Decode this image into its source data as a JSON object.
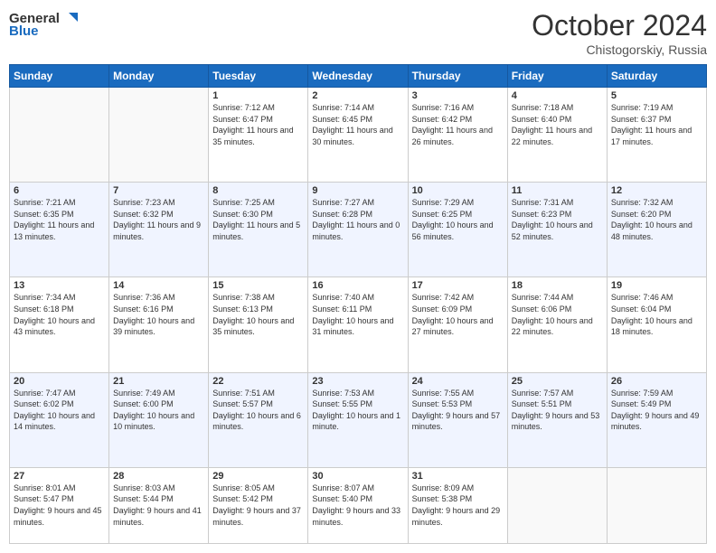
{
  "header": {
    "logo_line1": "General",
    "logo_line2": "Blue",
    "month_title": "October 2024",
    "location": "Chistogorskiy, Russia"
  },
  "days_of_week": [
    "Sunday",
    "Monday",
    "Tuesday",
    "Wednesday",
    "Thursday",
    "Friday",
    "Saturday"
  ],
  "weeks": [
    [
      {
        "day": "",
        "info": ""
      },
      {
        "day": "",
        "info": ""
      },
      {
        "day": "1",
        "info": "Sunrise: 7:12 AM\nSunset: 6:47 PM\nDaylight: 11 hours and 35 minutes."
      },
      {
        "day": "2",
        "info": "Sunrise: 7:14 AM\nSunset: 6:45 PM\nDaylight: 11 hours and 30 minutes."
      },
      {
        "day": "3",
        "info": "Sunrise: 7:16 AM\nSunset: 6:42 PM\nDaylight: 11 hours and 26 minutes."
      },
      {
        "day": "4",
        "info": "Sunrise: 7:18 AM\nSunset: 6:40 PM\nDaylight: 11 hours and 22 minutes."
      },
      {
        "day": "5",
        "info": "Sunrise: 7:19 AM\nSunset: 6:37 PM\nDaylight: 11 hours and 17 minutes."
      }
    ],
    [
      {
        "day": "6",
        "info": "Sunrise: 7:21 AM\nSunset: 6:35 PM\nDaylight: 11 hours and 13 minutes."
      },
      {
        "day": "7",
        "info": "Sunrise: 7:23 AM\nSunset: 6:32 PM\nDaylight: 11 hours and 9 minutes."
      },
      {
        "day": "8",
        "info": "Sunrise: 7:25 AM\nSunset: 6:30 PM\nDaylight: 11 hours and 5 minutes."
      },
      {
        "day": "9",
        "info": "Sunrise: 7:27 AM\nSunset: 6:28 PM\nDaylight: 11 hours and 0 minutes."
      },
      {
        "day": "10",
        "info": "Sunrise: 7:29 AM\nSunset: 6:25 PM\nDaylight: 10 hours and 56 minutes."
      },
      {
        "day": "11",
        "info": "Sunrise: 7:31 AM\nSunset: 6:23 PM\nDaylight: 10 hours and 52 minutes."
      },
      {
        "day": "12",
        "info": "Sunrise: 7:32 AM\nSunset: 6:20 PM\nDaylight: 10 hours and 48 minutes."
      }
    ],
    [
      {
        "day": "13",
        "info": "Sunrise: 7:34 AM\nSunset: 6:18 PM\nDaylight: 10 hours and 43 minutes."
      },
      {
        "day": "14",
        "info": "Sunrise: 7:36 AM\nSunset: 6:16 PM\nDaylight: 10 hours and 39 minutes."
      },
      {
        "day": "15",
        "info": "Sunrise: 7:38 AM\nSunset: 6:13 PM\nDaylight: 10 hours and 35 minutes."
      },
      {
        "day": "16",
        "info": "Sunrise: 7:40 AM\nSunset: 6:11 PM\nDaylight: 10 hours and 31 minutes."
      },
      {
        "day": "17",
        "info": "Sunrise: 7:42 AM\nSunset: 6:09 PM\nDaylight: 10 hours and 27 minutes."
      },
      {
        "day": "18",
        "info": "Sunrise: 7:44 AM\nSunset: 6:06 PM\nDaylight: 10 hours and 22 minutes."
      },
      {
        "day": "19",
        "info": "Sunrise: 7:46 AM\nSunset: 6:04 PM\nDaylight: 10 hours and 18 minutes."
      }
    ],
    [
      {
        "day": "20",
        "info": "Sunrise: 7:47 AM\nSunset: 6:02 PM\nDaylight: 10 hours and 14 minutes."
      },
      {
        "day": "21",
        "info": "Sunrise: 7:49 AM\nSunset: 6:00 PM\nDaylight: 10 hours and 10 minutes."
      },
      {
        "day": "22",
        "info": "Sunrise: 7:51 AM\nSunset: 5:57 PM\nDaylight: 10 hours and 6 minutes."
      },
      {
        "day": "23",
        "info": "Sunrise: 7:53 AM\nSunset: 5:55 PM\nDaylight: 10 hours and 1 minute."
      },
      {
        "day": "24",
        "info": "Sunrise: 7:55 AM\nSunset: 5:53 PM\nDaylight: 9 hours and 57 minutes."
      },
      {
        "day": "25",
        "info": "Sunrise: 7:57 AM\nSunset: 5:51 PM\nDaylight: 9 hours and 53 minutes."
      },
      {
        "day": "26",
        "info": "Sunrise: 7:59 AM\nSunset: 5:49 PM\nDaylight: 9 hours and 49 minutes."
      }
    ],
    [
      {
        "day": "27",
        "info": "Sunrise: 8:01 AM\nSunset: 5:47 PM\nDaylight: 9 hours and 45 minutes."
      },
      {
        "day": "28",
        "info": "Sunrise: 8:03 AM\nSunset: 5:44 PM\nDaylight: 9 hours and 41 minutes."
      },
      {
        "day": "29",
        "info": "Sunrise: 8:05 AM\nSunset: 5:42 PM\nDaylight: 9 hours and 37 minutes."
      },
      {
        "day": "30",
        "info": "Sunrise: 8:07 AM\nSunset: 5:40 PM\nDaylight: 9 hours and 33 minutes."
      },
      {
        "day": "31",
        "info": "Sunrise: 8:09 AM\nSunset: 5:38 PM\nDaylight: 9 hours and 29 minutes."
      },
      {
        "day": "",
        "info": ""
      },
      {
        "day": "",
        "info": ""
      }
    ]
  ]
}
